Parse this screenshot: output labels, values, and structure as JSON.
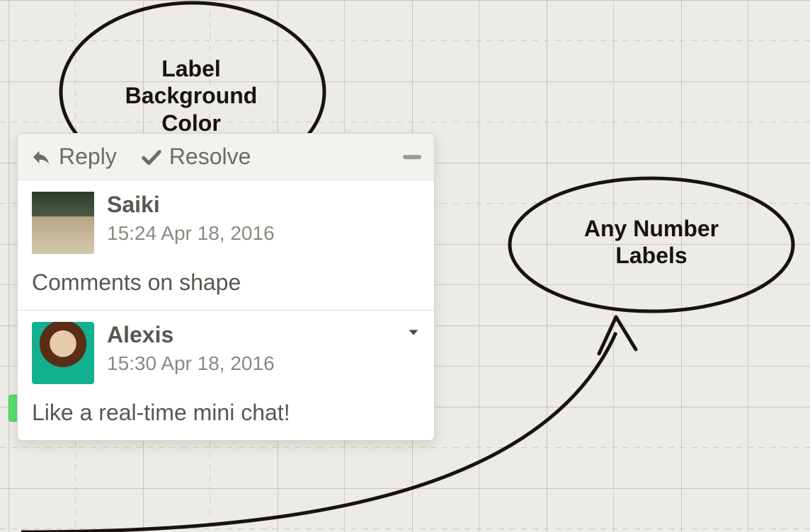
{
  "canvas": {
    "shapes": [
      {
        "id": "ellipse-1",
        "label_lines": [
          "Label",
          "Background",
          "Color"
        ]
      },
      {
        "id": "ellipse-2",
        "label_lines": [
          "Any Number",
          "Labels"
        ]
      }
    ]
  },
  "comment_panel": {
    "toolbar": {
      "reply_label": "Reply",
      "resolve_label": "Resolve"
    },
    "comments": [
      {
        "author": "Saiki",
        "timestamp": "15:24 Apr 18, 2016",
        "text": "Comments on shape",
        "has_menu": false
      },
      {
        "author": "Alexis",
        "timestamp": "15:30 Apr 18, 2016",
        "text": "Like a real-time mini chat!",
        "has_menu": true
      }
    ]
  }
}
